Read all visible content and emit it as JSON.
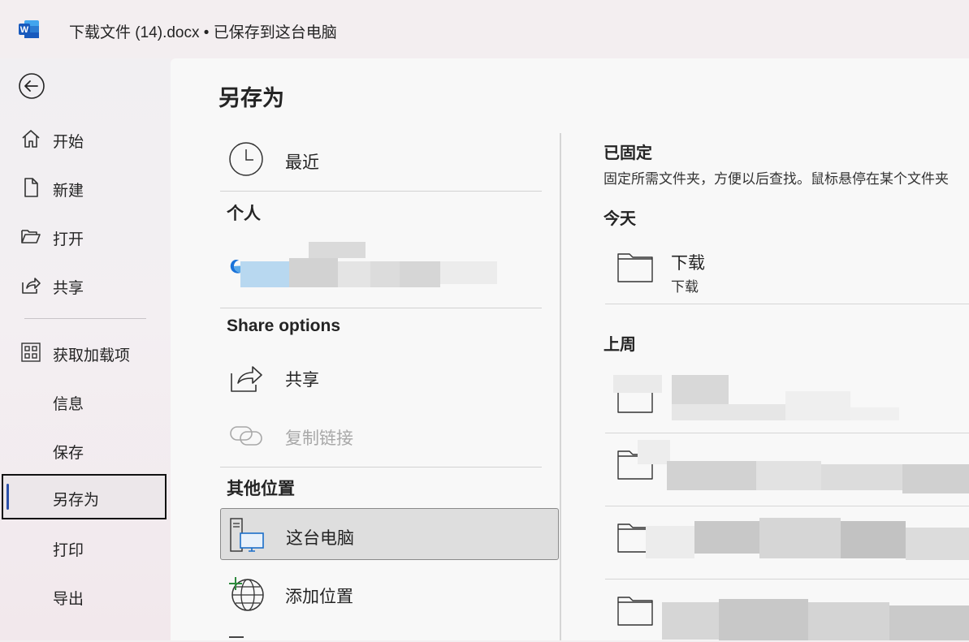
{
  "window": {
    "title": "下载文件 (14).docx • 已保存到这台电脑",
    "app_icon": "word-logo-icon",
    "app_icon_letter": "W",
    "accent_color": "#185abd"
  },
  "sidebar": {
    "back_icon": "back-arrow-icon",
    "items": [
      {
        "label": "开始",
        "icon": "home-icon"
      },
      {
        "label": "新建",
        "icon": "new-document-icon"
      },
      {
        "label": "打开",
        "icon": "open-folder-icon"
      },
      {
        "label": "共享",
        "icon": "share-icon"
      },
      {
        "label": "获取加载项",
        "icon": "add-ins-grid-icon"
      },
      {
        "label": "信息"
      },
      {
        "label": "保存"
      },
      {
        "label": "另存为",
        "selected": true
      },
      {
        "label": "打印"
      },
      {
        "label": "导出"
      }
    ]
  },
  "main": {
    "title": "另存为",
    "locations": {
      "recent_label": "最近",
      "personal_header": "个人",
      "share_header": "Share options",
      "share_label": "共享",
      "copy_link_label": "复制链接",
      "other_header": "其他位置",
      "this_pc_label": "这台电脑",
      "add_place_label": "添加位置"
    },
    "pinned": {
      "header": "已固定",
      "description": "固定所需文件夹，方便以后查找。鼠标悬停在某个文件夹"
    },
    "today": {
      "header": "今天",
      "folders": [
        {
          "name": "下载",
          "path": "下载"
        }
      ]
    },
    "last_week": {
      "header": "上周"
    }
  }
}
